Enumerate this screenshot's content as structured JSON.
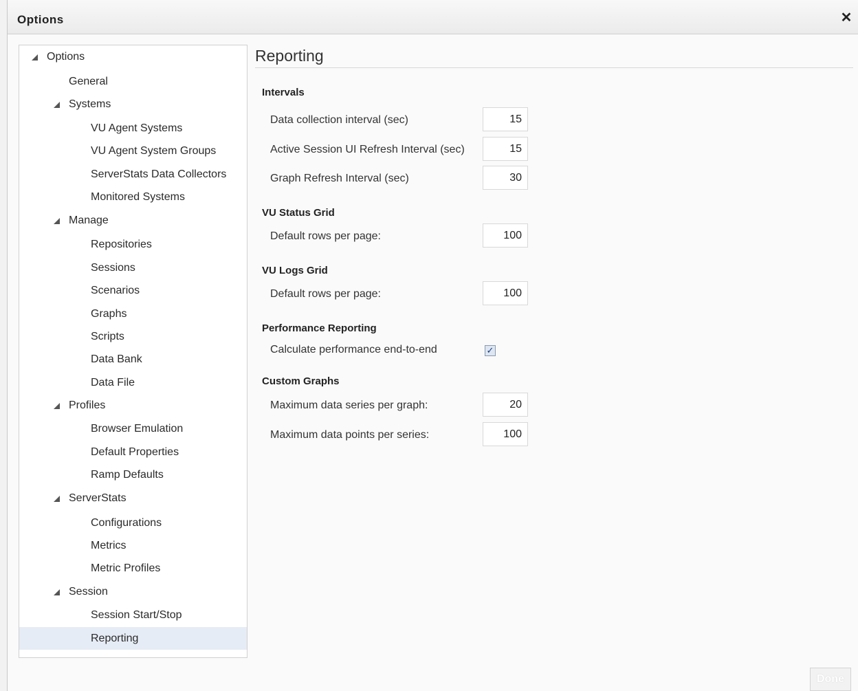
{
  "window": {
    "title": "Options",
    "close_glyph": "✕"
  },
  "tree": {
    "nodes": [
      {
        "label": "Options",
        "expanded": true
      },
      {
        "label": "General"
      },
      {
        "label": "Systems",
        "expanded": true
      },
      {
        "label": "VU Agent Systems"
      },
      {
        "label": "VU Agent System Groups"
      },
      {
        "label": "ServerStats Data Collectors"
      },
      {
        "label": "Monitored Systems"
      },
      {
        "label": "Manage",
        "expanded": true
      },
      {
        "label": "Repositories"
      },
      {
        "label": "Sessions"
      },
      {
        "label": "Scenarios"
      },
      {
        "label": "Graphs"
      },
      {
        "label": "Scripts"
      },
      {
        "label": "Data Bank"
      },
      {
        "label": "Data File"
      },
      {
        "label": "Profiles",
        "expanded": true
      },
      {
        "label": "Browser Emulation"
      },
      {
        "label": "Default Properties"
      },
      {
        "label": "Ramp Defaults"
      },
      {
        "label": "ServerStats",
        "expanded": true
      },
      {
        "label": "Configurations"
      },
      {
        "label": "Metrics"
      },
      {
        "label": "Metric Profiles"
      },
      {
        "label": "Session",
        "expanded": true
      },
      {
        "label": "Session Start/Stop"
      },
      {
        "label": "Reporting",
        "selected": true
      }
    ]
  },
  "reporting": {
    "heading": "Reporting",
    "intervals": {
      "title": "Intervals",
      "data_collection": {
        "label": "Data collection interval (sec)",
        "value": "15"
      },
      "active_session_refresh": {
        "label": "Active Session UI Refresh Interval (sec)",
        "value": "15"
      },
      "graph_refresh": {
        "label": "Graph Refresh Interval (sec)",
        "value": "30"
      }
    },
    "vu_status_grid": {
      "title": "VU Status Grid",
      "rows_per_page": {
        "label": "Default rows per page:",
        "value": "100"
      }
    },
    "vu_logs_grid": {
      "title": "VU Logs Grid",
      "rows_per_page": {
        "label": "Default rows per page:",
        "value": "100"
      }
    },
    "performance_reporting": {
      "title": "Performance Reporting",
      "end_to_end": {
        "label": "Calculate performance end-to-end",
        "checked": true,
        "check_glyph": "✓"
      }
    },
    "custom_graphs": {
      "title": "Custom Graphs",
      "max_series": {
        "label": "Maximum data series per graph:",
        "value": "20"
      },
      "max_points": {
        "label": "Maximum data points per series:",
        "value": "100"
      }
    }
  },
  "footer": {
    "done_label": "Done"
  },
  "colors": {
    "selected_row": "#e6ecf5",
    "checkbox_fill": "#dde6f2"
  }
}
